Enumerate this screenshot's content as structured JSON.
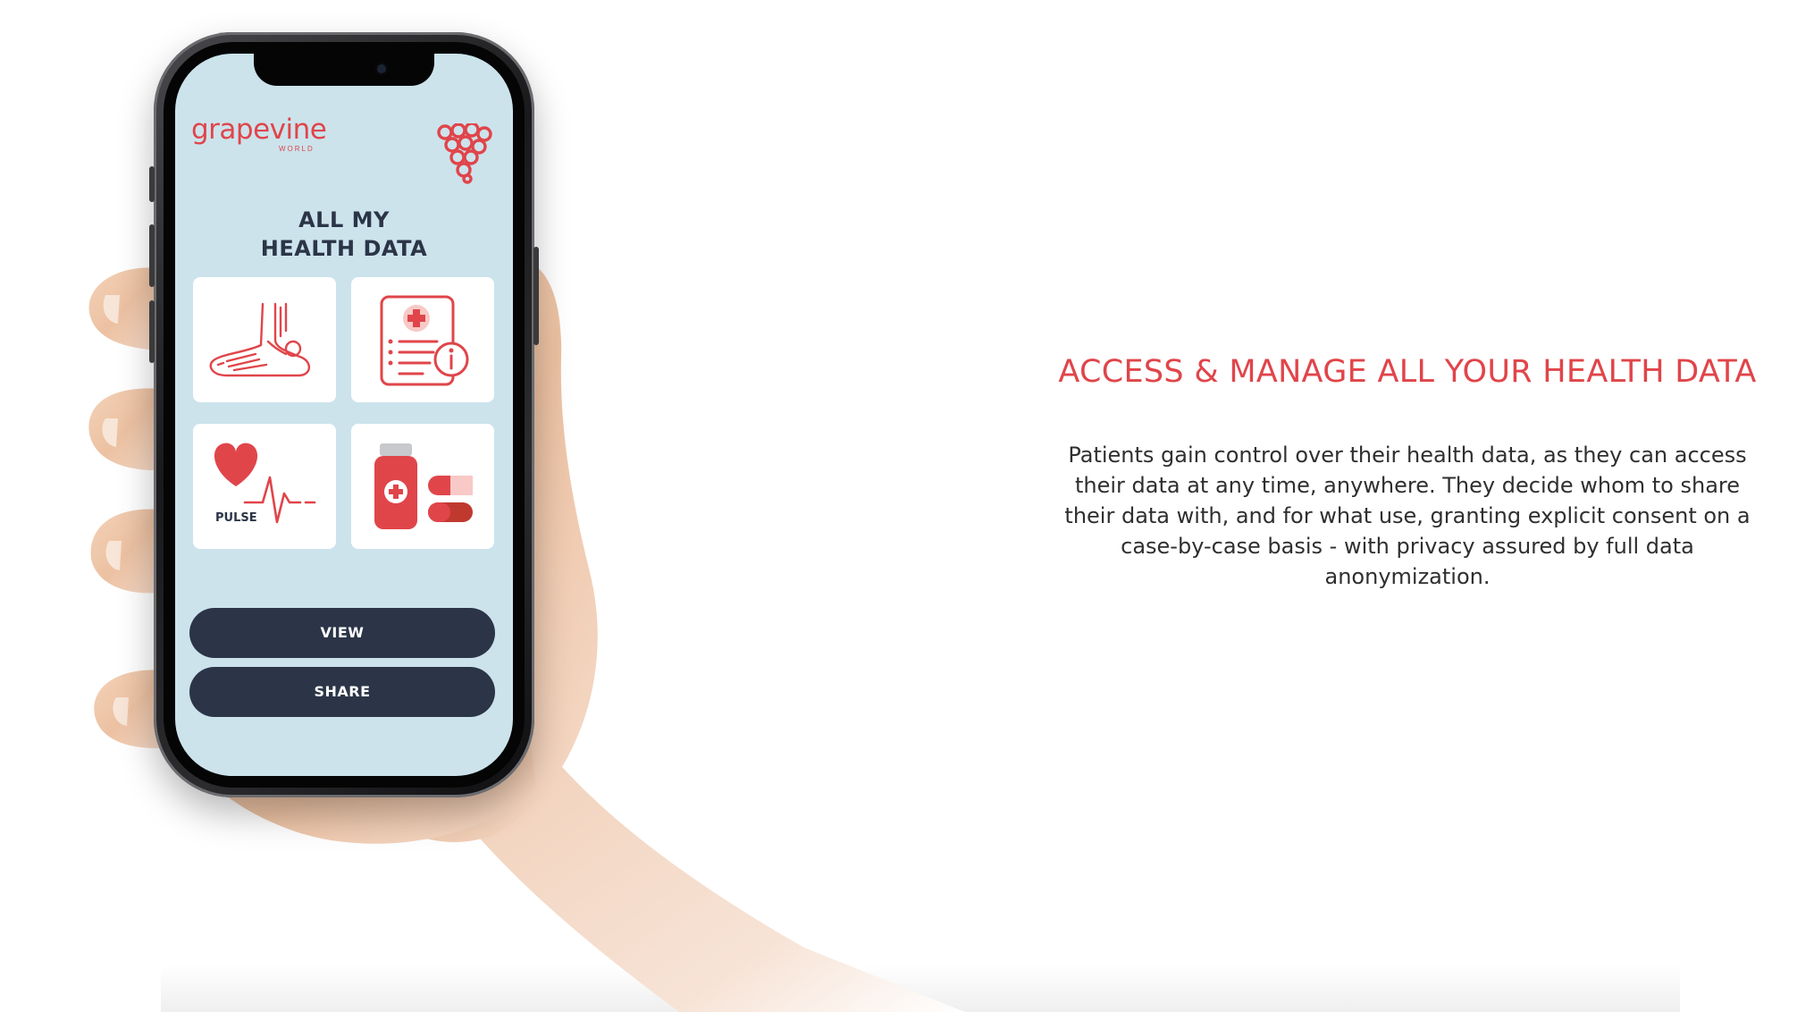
{
  "app": {
    "brand": "grapevine",
    "brand_sub": "WORLD",
    "screen_title_line1": "ALL MY",
    "screen_title_line2": "HEALTH DATA",
    "tiles": [
      {
        "icon": "foot-xray-icon"
      },
      {
        "icon": "medical-report-icon"
      },
      {
        "icon": "heart-pulse-icon",
        "label": "PULSE"
      },
      {
        "icon": "medication-icon"
      }
    ],
    "view_label": "VIEW",
    "share_label": "SHARE"
  },
  "promo": {
    "headline": "ACCESS & MANAGE ALL YOUR HEALTH DATA",
    "body": "Patients gain control over their health data, as they can access their data at any time, anywhere. They decide whom to share their data with, and for what use, granting explicit consent on a case-by-case basis - with privacy assured by full data anonymization."
  },
  "colors": {
    "accent": "#e0454a",
    "navy": "#2b3547",
    "screen_bg": "#cce3ec",
    "body_text": "#2f2f2f"
  }
}
